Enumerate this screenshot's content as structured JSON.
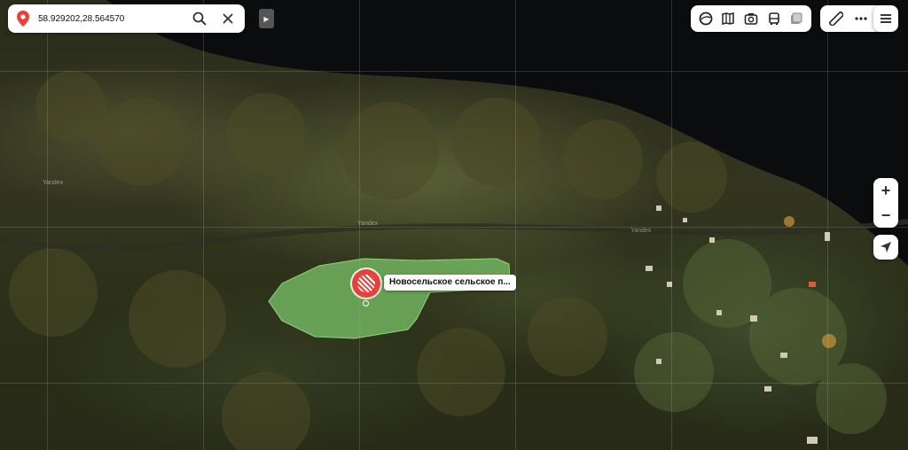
{
  "search": {
    "value": "58.929202,28.564570",
    "placeholder": ""
  },
  "map": {
    "watermark": "Yandex",
    "mode": "satellite",
    "parcel_color": "#7bc46a",
    "pin_color": "#e8403a"
  },
  "poi": {
    "label": "Новосельское сельское п..."
  },
  "toolbar": {
    "layers_icon": "layers-icon",
    "panorama_icon": "panorama-icon",
    "photo_icon": "camera-icon",
    "transit_icon": "bus-icon",
    "traffic_icon": "traffic-icon",
    "ruler_icon": "ruler-icon",
    "more_icon": "more-icon",
    "menu_icon": "menu-icon"
  },
  "zoom": {
    "in_label": "+",
    "out_label": "−"
  }
}
